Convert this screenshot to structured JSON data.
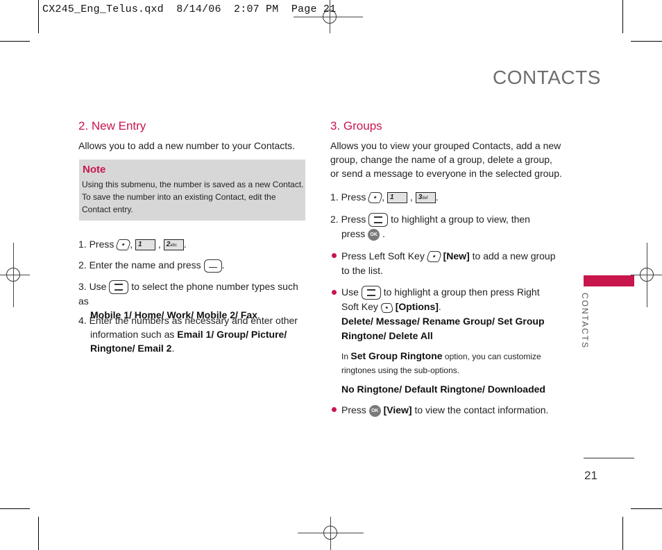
{
  "slug": {
    "text": "CX245_Eng_Telus.qxd  8/14/06  2:07 PM  Page 21"
  },
  "chapter_title": "CONTACTS",
  "side_tab_label": "CONTACTS",
  "page_number": "21",
  "colors": {
    "accent": "#c8154c",
    "note_background": "#d7d7d7",
    "title_gray": "#6e6e6e"
  },
  "new_entry": {
    "heading": "2. New Entry",
    "intro": "Allows you to add a new number to your Contacts.",
    "note": {
      "title": "Note",
      "text": "Using this submenu, the number is saved as a new Contact. To save the number into an existing Contact, edit the Contact entry."
    },
    "steps": [
      {
        "prefix": "1. Press",
        "keys": [
          "left-soft-key-icon",
          "1-key-icon",
          "2-abc-key-icon"
        ],
        "key_labels": [
          "",
          "1",
          "2"
        ],
        "key_sub": [
          "",
          "",
          "abc"
        ]
      },
      {
        "prefix": "2. Enter the name and press",
        "suffix": ".",
        "keys": [
          "end-key-icon"
        ]
      },
      {
        "prefix": "3. Use",
        "middle": "to select the phone number types such as",
        "options": "Mobile 1/ Home/ Work/ Mobile 2/ Fax",
        "suffix": ".",
        "keys": [
          "navigation-key-icon"
        ]
      },
      {
        "line1": "4. Enter the numbers as necessary and enter other",
        "line2_prefix": "information such as",
        "options_line2": "Email 1/ Group/ Picture/",
        "options_line3": "Ringtone/ Email 2",
        "suffix": "."
      }
    ]
  },
  "groups": {
    "heading": "3. Groups",
    "intro_lines": [
      "Allows you to view your grouped Contacts, add a new",
      "group, change the name of a group, delete a group,",
      "or send a message to everyone in the selected group."
    ],
    "step1": {
      "prefix": "1. Press",
      "key_labels": [
        "",
        "1",
        "3"
      ],
      "key_sub": [
        "",
        "",
        "def"
      ]
    },
    "step2": {
      "prefix": "2. Press",
      "middle": "to highlight a group to view, then",
      "line2_prefix": "press",
      "suffix": "."
    },
    "bullets": [
      {
        "prefix": "Press Left Soft Key",
        "bold": "[New]",
        "suffix": "to add a new group",
        "line2": "to the list."
      },
      {
        "prefix": "Use",
        "middle": "to highlight a group then press Right",
        "line2_prefix": "Soft Key",
        "bold": "[Options]",
        "suffix": ".",
        "options_line1": "Delete/ Message/ Rename Group/ Set Group",
        "options_line2": "Ringtone/ Delete All"
      },
      {
        "prefix": "Press",
        "bold": "[View]",
        "suffix": "to view the contact information."
      }
    ],
    "ringtone_note": {
      "prefix": "In",
      "bold": "Set Group Ringtone",
      "suffix": "option, you can customize",
      "line2": "ringtones using the sub-options."
    },
    "ringtone_options": "No Ringtone/ Default Ringtone/ Downloaded",
    "ok_label": "OK"
  }
}
